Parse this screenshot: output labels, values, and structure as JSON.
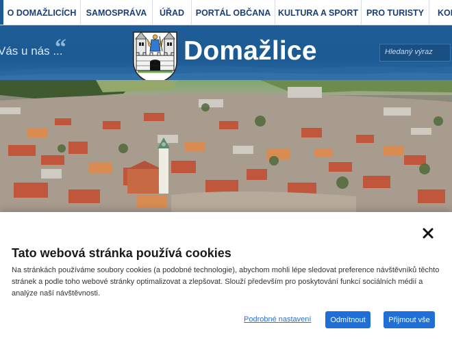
{
  "nav": {
    "items": [
      "O DOMAŽLICÍCH",
      "SAMOSPRÁVA",
      "ÚŘAD",
      "PORTÁL OBČANA",
      "KULTURA A SPORT",
      "PRO TURISTY",
      "KONT"
    ]
  },
  "header": {
    "tagline": "Vás u nás ...",
    "quote_mark": "“",
    "city_name": "Domažlice",
    "search_placeholder": "Hledaný výraz",
    "coat_icon": "coat-of-arms-icon"
  },
  "photo": {
    "subject": "aerial-town-photo"
  },
  "cookie": {
    "title": "Tato webová stránka používá cookies",
    "text": "Na stránkách používáme soubory cookies (a podobné technologie), abychom mohli lépe sledovat preference návštěvníků těchto stránek a podle toho webové stránky optimalizovat a zlepšovat. Slouží především pro poskytování funkcí sociálních médií a analýze naší návštěvnosti.",
    "settings_label": "Podrobné nastavení",
    "deny_label": "Odmítnout",
    "accept_label": "Přijmout vše",
    "close_icon": "close-icon"
  },
  "colors": {
    "brand_blue": "#1f5d98",
    "nav_text": "#1b3f73",
    "button_blue": "#1f6fd6",
    "link_blue": "#2f6fd0"
  }
}
